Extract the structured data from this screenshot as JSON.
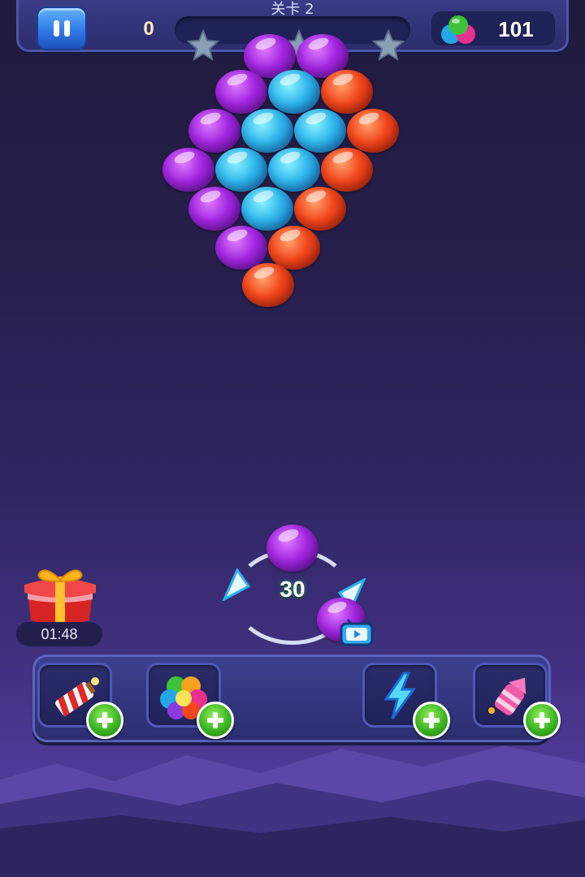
{
  "header": {
    "level_title": "关卡 2",
    "score": "0",
    "coins": "101",
    "stars_total": 3
  },
  "board": {
    "bubbles": [
      {
        "color": "purple"
      },
      {
        "color": "purple"
      },
      {
        "color": "purple"
      },
      {
        "color": "blue"
      },
      {
        "color": "red"
      },
      {
        "color": "purple"
      },
      {
        "color": "blue"
      },
      {
        "color": "blue"
      },
      {
        "color": "red"
      },
      {
        "color": "purple"
      },
      {
        "color": "blue"
      },
      {
        "color": "blue"
      },
      {
        "color": "red"
      },
      {
        "color": "purple"
      },
      {
        "color": "blue"
      },
      {
        "color": "red"
      },
      {
        "color": "purple"
      },
      {
        "color": "red"
      },
      {
        "color": "red"
      }
    ]
  },
  "shooter": {
    "shots_left": "30",
    "current_bubble": "purple",
    "next_bubble": "purple"
  },
  "gift": {
    "timer": "01:48"
  },
  "boosters": [
    {
      "name": "firecracker"
    },
    {
      "name": "rainbow-ball"
    },
    {
      "name": "lightning"
    },
    {
      "name": "rocket"
    }
  ],
  "colors": {
    "purple": "#a226e0",
    "blue": "#2fb6ec",
    "red": "#f2461b",
    "plus_green": "#3cb321"
  }
}
